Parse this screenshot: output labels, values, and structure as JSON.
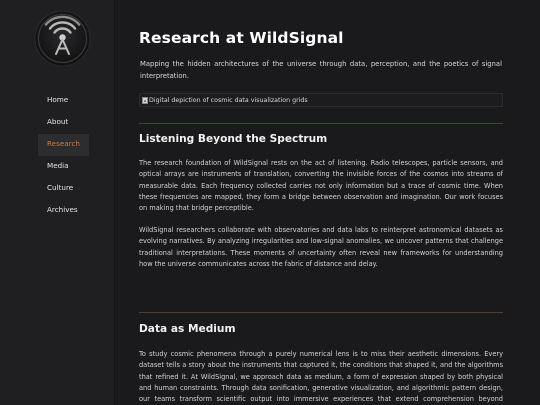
{
  "nav": {
    "items": [
      {
        "label": "Home"
      },
      {
        "label": "About"
      },
      {
        "label": "Research",
        "active": true
      },
      {
        "label": "Media"
      },
      {
        "label": "Culture"
      },
      {
        "label": "Archives"
      }
    ]
  },
  "main": {
    "title": "Research at WildSignal",
    "intro": "Mapping the hidden architectures of the universe through data, perception, and the poetics of signal interpretation.",
    "image_alt": "Digital depiction of cosmic data visualization grids",
    "sections": [
      {
        "heading": "Listening Beyond the Spectrum",
        "paragraphs": [
          "The research foundation of WildSignal rests on the act of listening. Radio telescopes, particle sensors, and optical arrays are instruments of translation, converting the invisible forces of the cosmos into streams of measurable data. Each frequency collected carries not only information but a trace of cosmic time. When these frequencies are mapped, they form a bridge between observation and imagination. Our work focuses on making that bridge perceptible.",
          "WildSignal researchers collaborate with observatories and data labs to reinterpret astronomical datasets as evolving narratives. By analyzing irregularities and low-signal anomalies, we uncover patterns that challenge traditional interpretations. These moments of uncertainty often reveal new frameworks for understanding how the universe communicates across the fabric of distance and delay."
        ]
      },
      {
        "heading": "Data as Medium",
        "paragraphs": [
          "To study cosmic phenomena through a purely numerical lens is to miss their aesthetic dimensions. Every dataset tells a story about the instruments that captured it, the conditions that shaped it, and the algorithms that refined it. At WildSignal, we approach data as medium, a form of expression shaped by both physical and human constraints. Through data sonification, generative visualization, and algorithmic pattern design, our teams transform scientific output into immersive experiences that extend comprehension beyond language."
        ]
      }
    ]
  },
  "colors": {
    "accent": "#c87a4a",
    "rule": "#5a3a2e",
    "background": "#1a1a1c"
  }
}
